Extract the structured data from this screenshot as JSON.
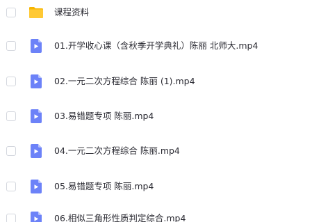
{
  "file_list": {
    "items": [
      {
        "type": "folder",
        "icon": "folder-icon",
        "name": "课程资料"
      },
      {
        "type": "video",
        "icon": "video-file-icon",
        "name": "01.开学收心课（含秋季开学典礼）陈丽 北师大.mp4"
      },
      {
        "type": "video",
        "icon": "video-file-icon",
        "name": "02.一元二次方程综合 陈丽 (1).mp4"
      },
      {
        "type": "video",
        "icon": "video-file-icon",
        "name": "03.易错题专项 陈丽.mp4"
      },
      {
        "type": "video",
        "icon": "video-file-icon",
        "name": "04.一元二次方程综合 陈丽.mp4"
      },
      {
        "type": "video",
        "icon": "video-file-icon",
        "name": "05.易错题专项 陈丽.mp4"
      },
      {
        "type": "video",
        "icon": "video-file-icon",
        "name": "06.相似三角形性质判定综合.mp4"
      }
    ]
  },
  "colors": {
    "folder": "#ffc935",
    "folder_back": "#f7b500",
    "video_file": "#6c82f8",
    "video_fold": "#b6c2fc",
    "checkbox_border": "#d4d7de",
    "text": "#2b2b33"
  }
}
